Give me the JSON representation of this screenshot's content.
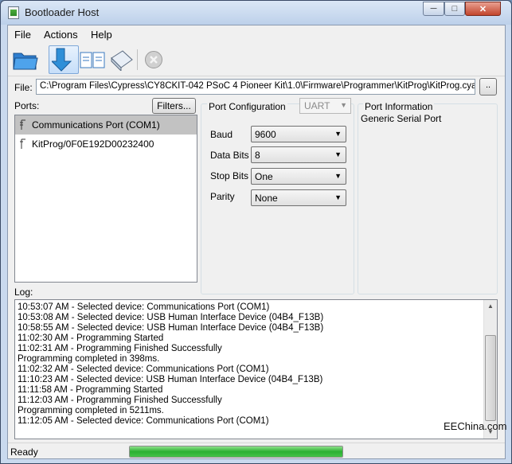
{
  "window": {
    "title": "Bootloader Host"
  },
  "menu": {
    "items": [
      "File",
      "Actions",
      "Help"
    ]
  },
  "file": {
    "label": "File:",
    "path": "C:\\Program Files\\Cypress\\CY8CKIT-042 PSoC 4 Pioneer Kit\\1.0\\Firmware\\Programmer\\KitProg\\KitProg.cyacd",
    "browse_label": ".."
  },
  "ports": {
    "label": "Ports:",
    "filters_label": "Filters...",
    "items": [
      "Communications Port (COM1)",
      "KitProg/0F0E192D00232400"
    ],
    "selected_index": 0
  },
  "port_config": {
    "title": "Port Configuration",
    "protocol": "UART",
    "fields": [
      {
        "label": "Baud",
        "value": "9600"
      },
      {
        "label": "Data Bits",
        "value": "8"
      },
      {
        "label": "Stop Bits",
        "value": "One"
      },
      {
        "label": "Parity",
        "value": "None"
      }
    ]
  },
  "port_info": {
    "title": "Port Information",
    "text": "Generic Serial Port"
  },
  "log": {
    "label": "Log:",
    "lines": [
      "10:53:07 AM - Selected device: Communications Port (COM1)",
      "10:53:08 AM - Selected device: USB Human Interface Device (04B4_F13B)",
      "10:58:55 AM - Selected device: USB Human Interface Device (04B4_F13B)",
      "11:02:30 AM - Programming Started",
      "11:02:31 AM - Programming Finished Successfully",
      "Programming completed in 398ms.",
      "11:02:32 AM - Selected device: Communications Port (COM1)",
      "11:10:23 AM - Selected device: USB Human Interface Device (04B4_F13B)",
      "11:11:58 AM - Programming Started",
      "11:12:03 AM - Programming Finished Successfully",
      "Programming completed in 5211ms.",
      "11:12:05 AM - Selected device: Communications Port (COM1)"
    ]
  },
  "status": {
    "text": "Ready",
    "progress": 1.0
  },
  "watermark": "EEChina.com",
  "colors": {
    "progress": "#2bb032",
    "selection": "#c2c2c2"
  }
}
